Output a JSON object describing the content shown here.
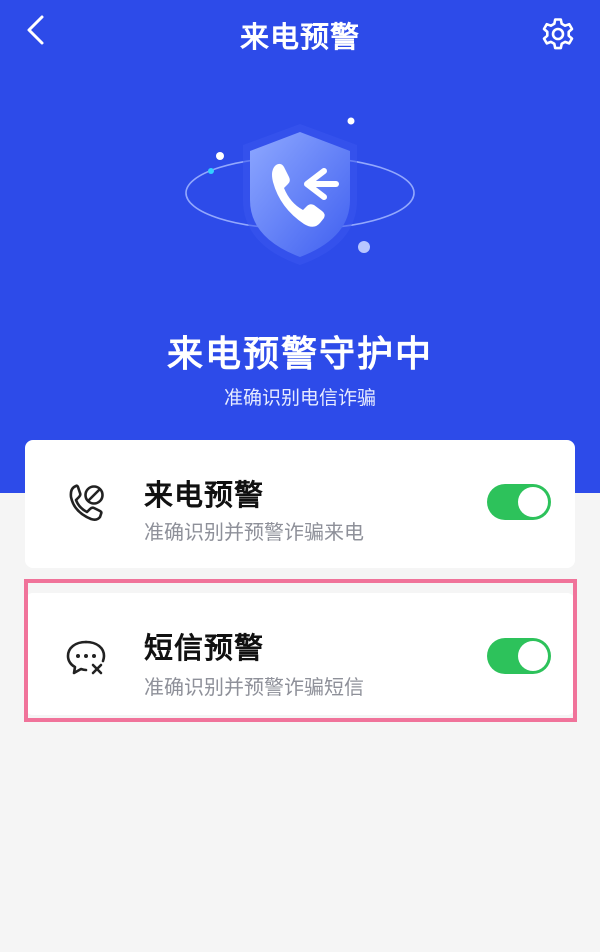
{
  "header": {
    "title": "来电预警",
    "back_icon": "chevron-left-icon",
    "settings_icon": "gear-icon"
  },
  "hero": {
    "title": "来电预警守护中",
    "subtitle": "准确识别电信诈骗",
    "icon": "shield-incoming-call-icon"
  },
  "features": [
    {
      "title": "来电预警",
      "description": "准确识别并预警诈骗来电",
      "icon": "phone-block-icon",
      "enabled": true
    },
    {
      "title": "短信预警",
      "description": "准确识别并预警诈骗短信",
      "icon": "message-block-icon",
      "enabled": true
    }
  ],
  "colors": {
    "primary": "#2d4be9",
    "toggle_on": "#2dc25b",
    "highlight": "#f0739a"
  }
}
